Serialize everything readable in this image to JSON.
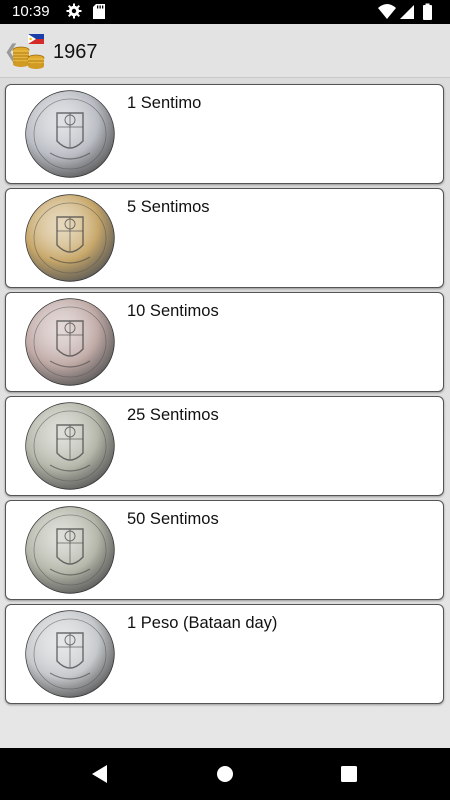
{
  "status_bar": {
    "time": "10:39",
    "icons": [
      "gear-icon",
      "sd-card-icon",
      "wifi-icon",
      "signal-icon",
      "battery-icon"
    ]
  },
  "app_bar": {
    "back_icon": "chevron-left-icon",
    "logo_icon": "philippines-flag-coins-icon",
    "title": "1967"
  },
  "coins": [
    {
      "label": "1 Sentimo",
      "metal": "aluminium"
    },
    {
      "label": "5 Sentimos",
      "metal": "brass"
    },
    {
      "label": "10 Sentimos",
      "metal": "copper-nickel"
    },
    {
      "label": "25 Sentimos",
      "metal": "nickel"
    },
    {
      "label": "50 Sentimos",
      "metal": "nickel"
    },
    {
      "label": "1 Peso (Bataan day)",
      "metal": "silver"
    }
  ],
  "colors": {
    "aluminium": "#b9bcc3",
    "brass": "#c8a86a",
    "copper-nickel": "#c0aaa6",
    "nickel": "#b3b6a8",
    "silver": "#c6c9cc"
  },
  "nav_bar": {
    "icons": [
      "nav-back-icon",
      "nav-home-icon",
      "nav-recents-icon"
    ]
  }
}
